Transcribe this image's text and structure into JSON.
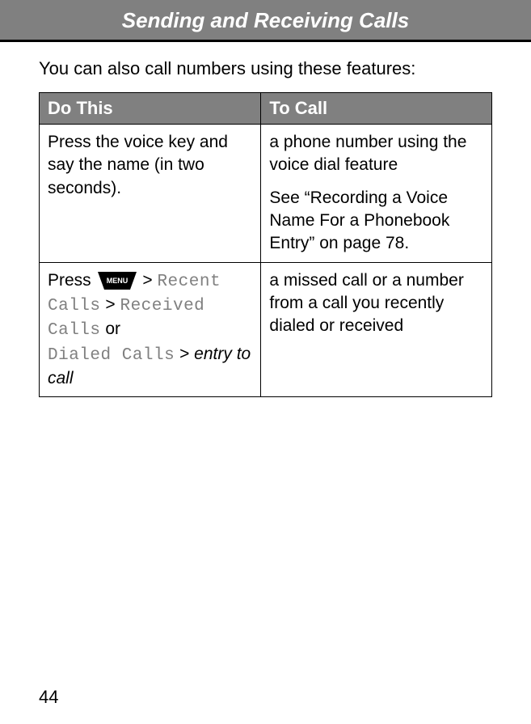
{
  "header": {
    "title": "Sending and Receiving Calls"
  },
  "intro": "You can also call numbers using these features:",
  "table": {
    "headers": {
      "col1": "Do This",
      "col2": "To Call"
    },
    "row1": {
      "left": "Press the voice key and say the name (in two seconds).",
      "right_p1": "a phone number using the voice dial feature",
      "right_p2": "See “Recording a Voice Name For a Phonebook Entry” on page 78."
    },
    "row2": {
      "left_press": "Press ",
      "left_menu_label": "MENU",
      "left_gt1": " > ",
      "left_recent": "Recent Calls",
      "left_gt2": " > ",
      "left_received": "Received Calls",
      "left_or": " or ",
      "left_dialed": "Dialed Calls",
      "left_gt3": " > ",
      "left_entry": "entry to call",
      "right": "a missed call or a number from a call you recently dialed or received"
    }
  },
  "page_number": "44"
}
